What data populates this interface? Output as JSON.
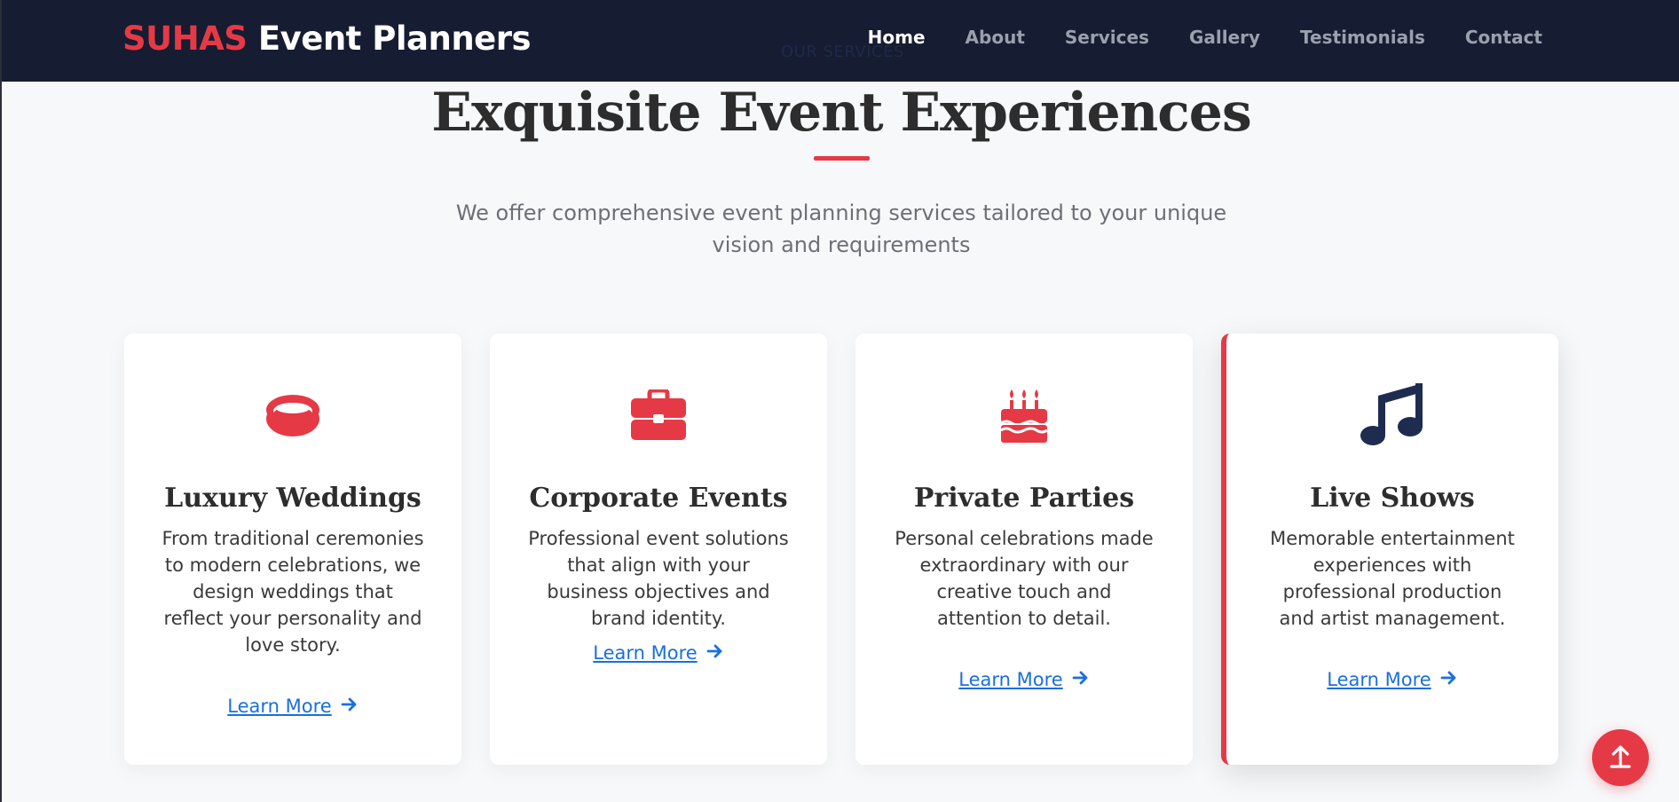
{
  "navbar": {
    "brand_accent": "SUHAS",
    "brand_rest": " Event Planners",
    "links": [
      {
        "label": "Home",
        "active": true
      },
      {
        "label": "About"
      },
      {
        "label": "Services"
      },
      {
        "label": "Gallery"
      },
      {
        "label": "Testimonials"
      },
      {
        "label": "Contact"
      }
    ]
  },
  "section": {
    "eyebrow": "OUR SERVICES",
    "title": "Exquisite Event Experiences",
    "subtitle": "We offer comprehensive event planning services tailored to your unique vision and requirements"
  },
  "cards": [
    {
      "icon": "ring-icon",
      "title": "Luxury Weddings",
      "description": "From traditional ceremonies to modern celebrations, we design weddings that reflect your personality and love story.",
      "link": "Learn More "
    },
    {
      "icon": "briefcase-icon",
      "title": "Corporate Events",
      "description": "Professional event solutions that align with your business objectives and brand identity.",
      "link": "Learn More "
    },
    {
      "icon": "birthday-cake-icon",
      "title": "Private Parties",
      "description": "Personal celebrations made extraordinary with our creative touch and attention to detail.",
      "link": "Learn More "
    },
    {
      "icon": "music-note-icon",
      "title": "Live Shows",
      "description": "Memorable entertainment experiences with professional production and artist management.",
      "link": "Learn More ",
      "featured": true
    }
  ],
  "back_to_top": {
    "icon": "arrow-up-icon"
  },
  "colors": {
    "accent": "#e63946",
    "navbar_bg": "#161c31",
    "link": "#1a6fe0",
    "dark_icon": "#1e2d4f"
  }
}
